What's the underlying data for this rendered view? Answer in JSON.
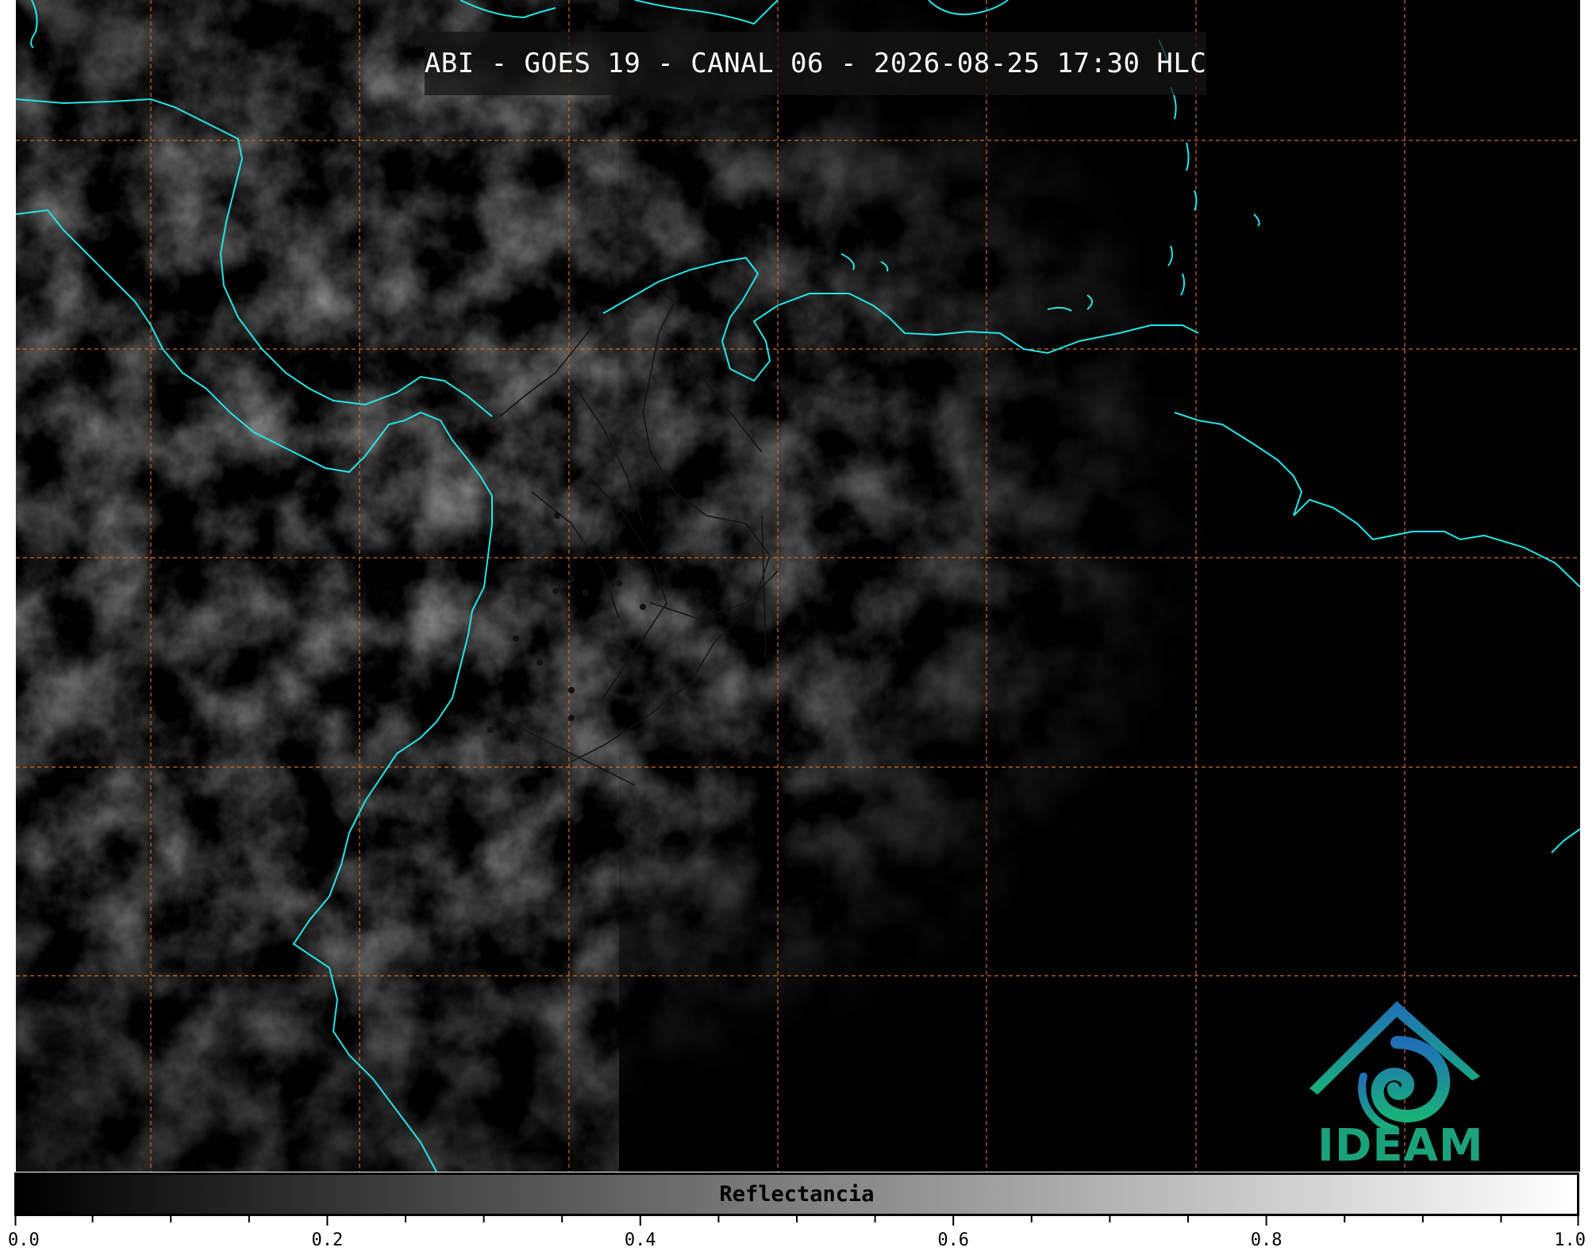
{
  "title": "ABI - GOES 19 - CANAL 06 - 2026-08-25 17:30 HLC",
  "colors": {
    "coastline": "#22e6e6",
    "gridline": "#d2691e",
    "borders": "#111111",
    "logo_text": "#1aa37a"
  },
  "logo": {
    "text": "IDEAM",
    "icon": "ideam-mountain-spiral-icon"
  },
  "colorbar": {
    "label": "Reflectancia",
    "min": 0.0,
    "max": 1.0,
    "tick_labels": [
      "0.0",
      "0.2",
      "0.4",
      "0.6",
      "0.8",
      "1.0"
    ],
    "tick_values": [
      0.0,
      0.2,
      0.4,
      0.6,
      0.8,
      1.0
    ],
    "minor_tick_step": 0.05,
    "colormap": [
      "#000000",
      "#ffffff"
    ]
  }
}
